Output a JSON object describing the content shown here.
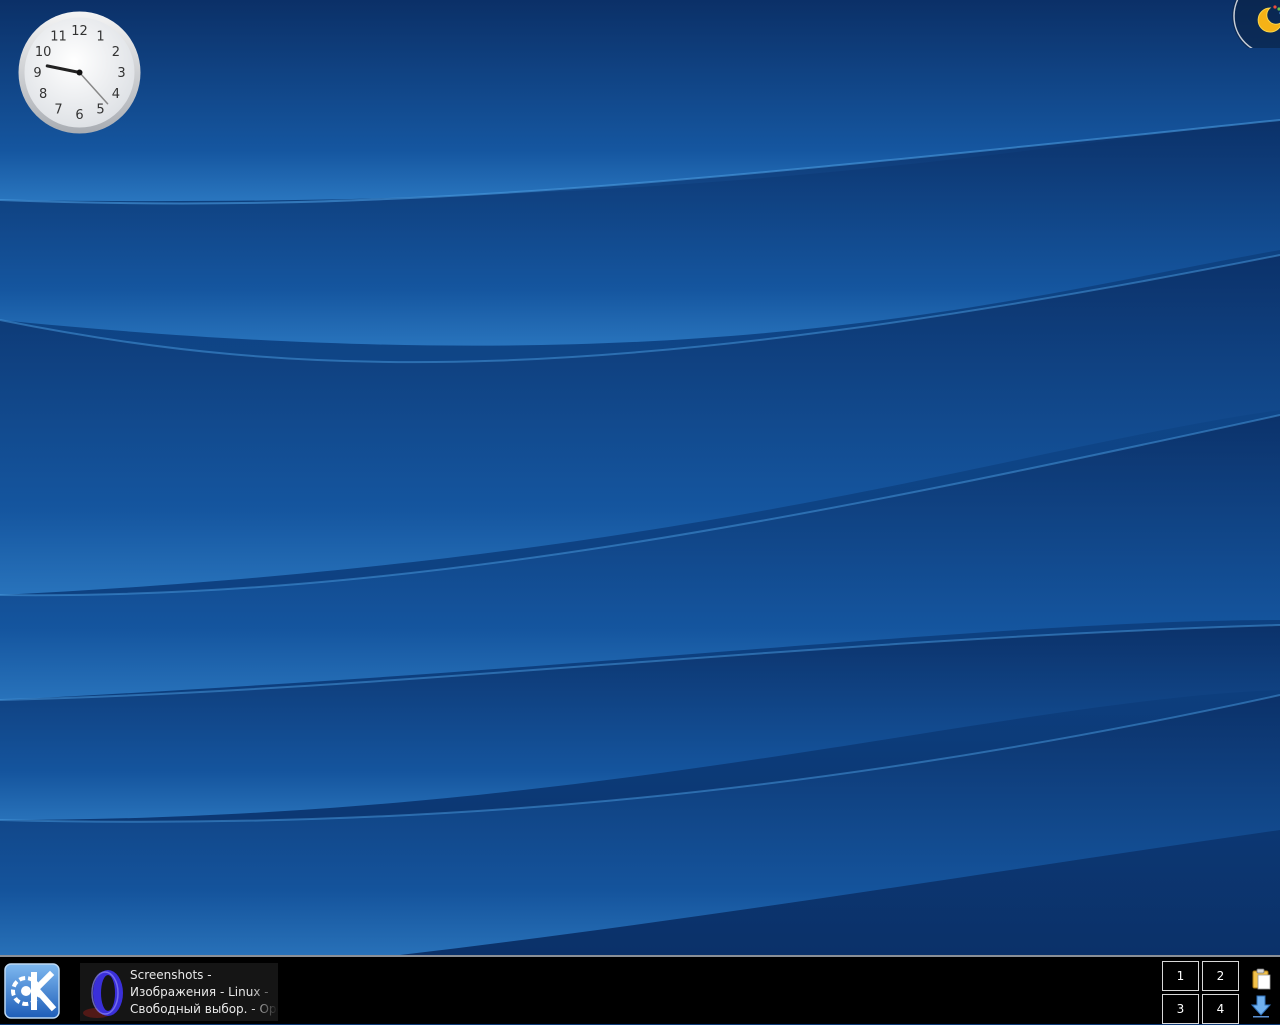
{
  "clock": {
    "numerals": [
      "12",
      "1",
      "2",
      "3",
      "4",
      "5",
      "6",
      "7",
      "8",
      "9",
      "10",
      "11"
    ],
    "time": "9:23"
  },
  "taskbar": {
    "kmenu_icon": "kde-logo-icon",
    "task": {
      "icon": "opera-icon",
      "line1": "Screenshots -",
      "line2": "Изображения - Linux -",
      "line3": "Свободный выбор. - Opera"
    },
    "pager": {
      "desktops": [
        "1",
        "2",
        "3",
        "4"
      ]
    },
    "tray": [
      "clipboard-icon",
      "download-arrow-icon"
    ]
  },
  "colors": {
    "wallpaper": "#0f4688",
    "panel": "#000000",
    "accent": "#3d8fd6"
  }
}
